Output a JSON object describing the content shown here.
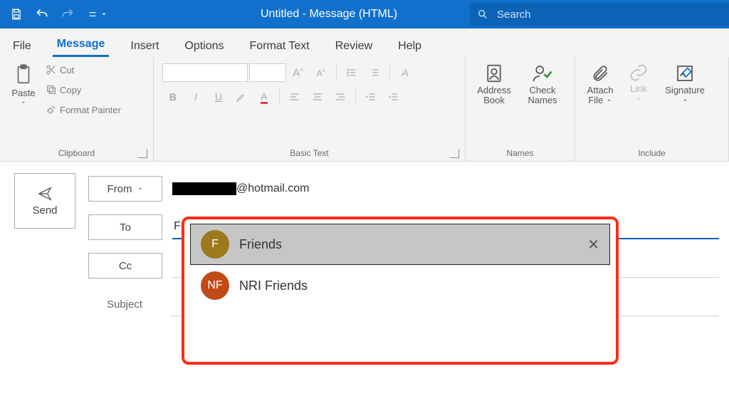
{
  "titlebar": {
    "title": "Untitled  -  Message (HTML)",
    "search_placeholder": "Search"
  },
  "tabs": {
    "file": "File",
    "message": "Message",
    "insert": "Insert",
    "options": "Options",
    "format_text": "Format Text",
    "review": "Review",
    "help": "Help"
  },
  "ribbon": {
    "clipboard": {
      "paste": "Paste",
      "cut": "Cut",
      "copy": "Copy",
      "painter": "Format Painter",
      "label": "Clipboard"
    },
    "basic_text": {
      "label": "Basic Text"
    },
    "names": {
      "address_book": "Address Book",
      "check_names": "Check Names",
      "label": "Names"
    },
    "include": {
      "attach_file": "Attach File",
      "link": "Link",
      "signature": "Signature",
      "label": "Include"
    }
  },
  "compose": {
    "send": "Send",
    "from": "From",
    "from_value_suffix": "@hotmail.com",
    "to": "To",
    "to_value": "Friends",
    "cc": "Cc",
    "subject": "Subject"
  },
  "autocomplete": {
    "items": [
      {
        "initials": "F",
        "name": "Friends",
        "selected": true
      },
      {
        "initials": "NF",
        "name": "NRI Friends",
        "selected": false
      }
    ]
  },
  "colors": {
    "accent": "#1170cc",
    "highlight_border": "#ff2b18"
  }
}
